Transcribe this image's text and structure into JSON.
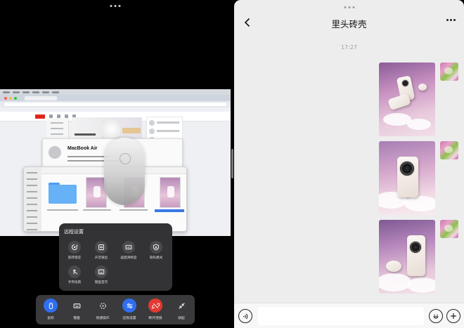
{
  "left_pane": {
    "mac_screen": {
      "about_window": {
        "model_name": "MacBook Air"
      }
    },
    "remote_settings": {
      "title": "远程设置",
      "items": [
        {
          "label": "旋转锁定",
          "icon": "rotation-lock-icon"
        },
        {
          "label": "声音输出",
          "icon": "sound-output-icon"
        },
        {
          "label": "画面清晰度",
          "icon": "hd-icon"
        },
        {
          "label": "隐私模式",
          "icon": "privacy-icon"
        },
        {
          "label": "手势指南",
          "icon": "gesture-guide-icon"
        },
        {
          "label": "键盘首页",
          "icon": "keyboard-home-icon"
        }
      ]
    },
    "toolbar": {
      "items": [
        {
          "label": "鼠标",
          "icon": "mouse-icon",
          "bg": "#2f6ef0"
        },
        {
          "label": "键盘",
          "icon": "keyboard-icon",
          "bg": "#3a3a3c"
        },
        {
          "label": "快捷操作",
          "icon": "shortcut-icon",
          "bg": "#3a3a3c"
        },
        {
          "label": "远程设置",
          "icon": "settings-icon",
          "bg": "#2f6ef0"
        },
        {
          "label": "断开连接",
          "icon": "disconnect-icon",
          "bg": "#e23a32"
        },
        {
          "label": "收起",
          "icon": "collapse-icon",
          "bg": "#3a3a3c"
        }
      ]
    }
  },
  "chat": {
    "title": "里头砖壳",
    "timestamp": "17:27",
    "input_value": "",
    "colors": {
      "background": "#ededed",
      "input_bar": "#f7f7f7"
    }
  }
}
